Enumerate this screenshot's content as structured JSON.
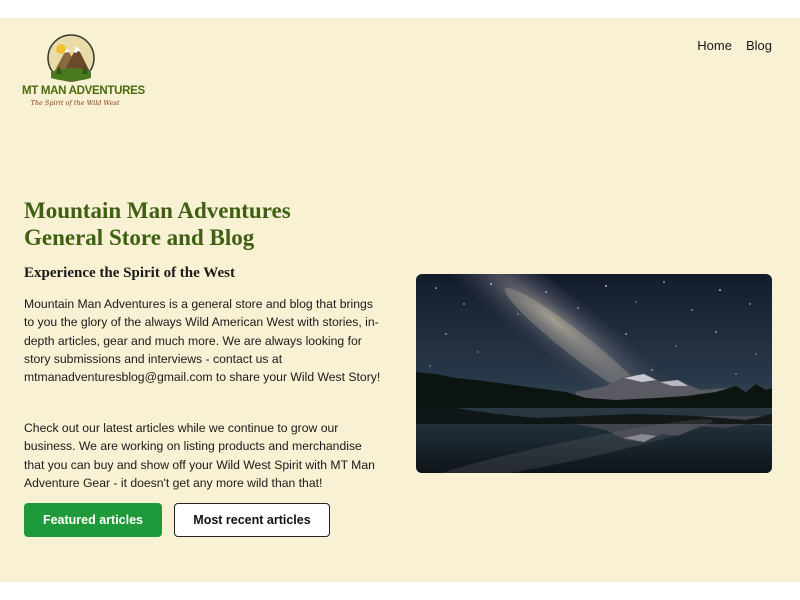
{
  "logo": {
    "name": "MT MAN ADVENTURES",
    "tagline": "The Spirit of the Wild West"
  },
  "nav": {
    "items": [
      {
        "label": "Home"
      },
      {
        "label": "Blog"
      }
    ]
  },
  "hero": {
    "title": "Mountain Man Adventures General Store and Blog",
    "subtitle": "Experience the Spirit of the West",
    "paragraphs": [
      "Mountain Man Adventures is a general store and blog that brings to you the glory of the always Wild American West with stories, in-depth articles, gear and much more. We are always looking for story submissions and interviews - contact us at mtmanadventuresblog@gmail.com to share your Wild West Story!",
      "Check out our latest articles while we continue to grow our business. We are working on listing products and merchandise that you can buy and show off your Wild West Spirit with MT Man Adventure Gear - it doesn't get any more wild than that!"
    ],
    "buttons": {
      "primary": "Featured articles",
      "secondary": "Most recent articles"
    }
  },
  "colors": {
    "background": "#f8f1d3",
    "title": "#3f5f12",
    "primary_button": "#1f9a3a"
  }
}
